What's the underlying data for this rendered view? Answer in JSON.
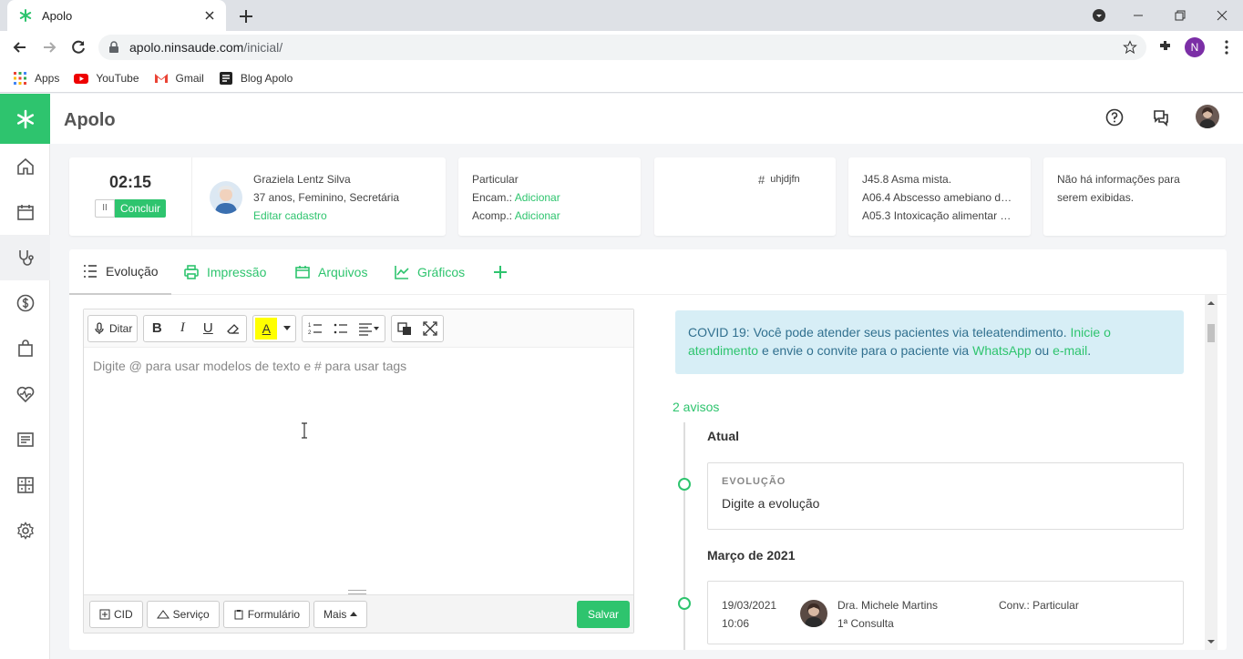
{
  "browser": {
    "tab_title": "Apolo",
    "url_host": "apolo.ninsaude.com",
    "url_path": "/inicial/",
    "profile_initial": "N",
    "bookmarks": [
      {
        "label": "Apps",
        "icon": "apps-grid-icon"
      },
      {
        "label": "YouTube",
        "icon": "youtube-icon"
      },
      {
        "label": "Gmail",
        "icon": "gmail-icon"
      },
      {
        "label": "Blog Apolo",
        "icon": "blog-icon"
      }
    ]
  },
  "app": {
    "title": "Apolo",
    "accent_color": "#2ec46e"
  },
  "session": {
    "timer": "02:15",
    "pause_label": "II",
    "conclude_label": "Concluir"
  },
  "patient": {
    "name": "Graziela Lentz Silva",
    "details": "37 anos, Feminino, Secretária",
    "edit_label": "Editar cadastro"
  },
  "insurance": {
    "type": "Particular",
    "encam_label": "Encam.:",
    "encam_action": "Adicionar",
    "acomp_label": "Acomp.:",
    "acomp_action": "Adicionar"
  },
  "tags": {
    "tag": "uhjdjfn"
  },
  "diagnoses": [
    "J45.8 Asma mista.",
    "A06.4 Abscesso amebiano do…",
    "A05.3 Intoxicação alimentar d…"
  ],
  "extra_info": {
    "line1": "Não há informações para",
    "line2": "serem exibidas."
  },
  "tabs": [
    {
      "label": "Evolução"
    },
    {
      "label": "Impressão"
    },
    {
      "label": "Arquivos"
    },
    {
      "label": "Gráficos"
    }
  ],
  "editor": {
    "dictate_label": "Ditar",
    "placeholder": "Digite @ para usar modelos de texto e # para usar tags",
    "footer": {
      "cid": "CID",
      "servico": "Serviço",
      "formulario": "Formulário",
      "mais": "Mais",
      "save": "Salvar"
    }
  },
  "notice": {
    "text1": "COVID 19: Você pode atender seus pacientes via teleatendimento. ",
    "link1": "Inicie o atendimento",
    "text2": " e envie o convite para o paciente via ",
    "link2": "WhatsApp",
    "text3": " ou ",
    "link3": "e-mail",
    "text4": "."
  },
  "timeline": {
    "avisos": "2 avisos",
    "current_label": "Atual",
    "evolucao_label": "EVOLUÇÃO",
    "evolucao_value": "Digite a evolução",
    "month_label": "Março de 2021",
    "entry": {
      "date": "19/03/2021",
      "time": "10:06",
      "doctor": "Dra. Michele Martins",
      "consult": "1ª Consulta",
      "conv": "Conv.: Particular"
    }
  }
}
